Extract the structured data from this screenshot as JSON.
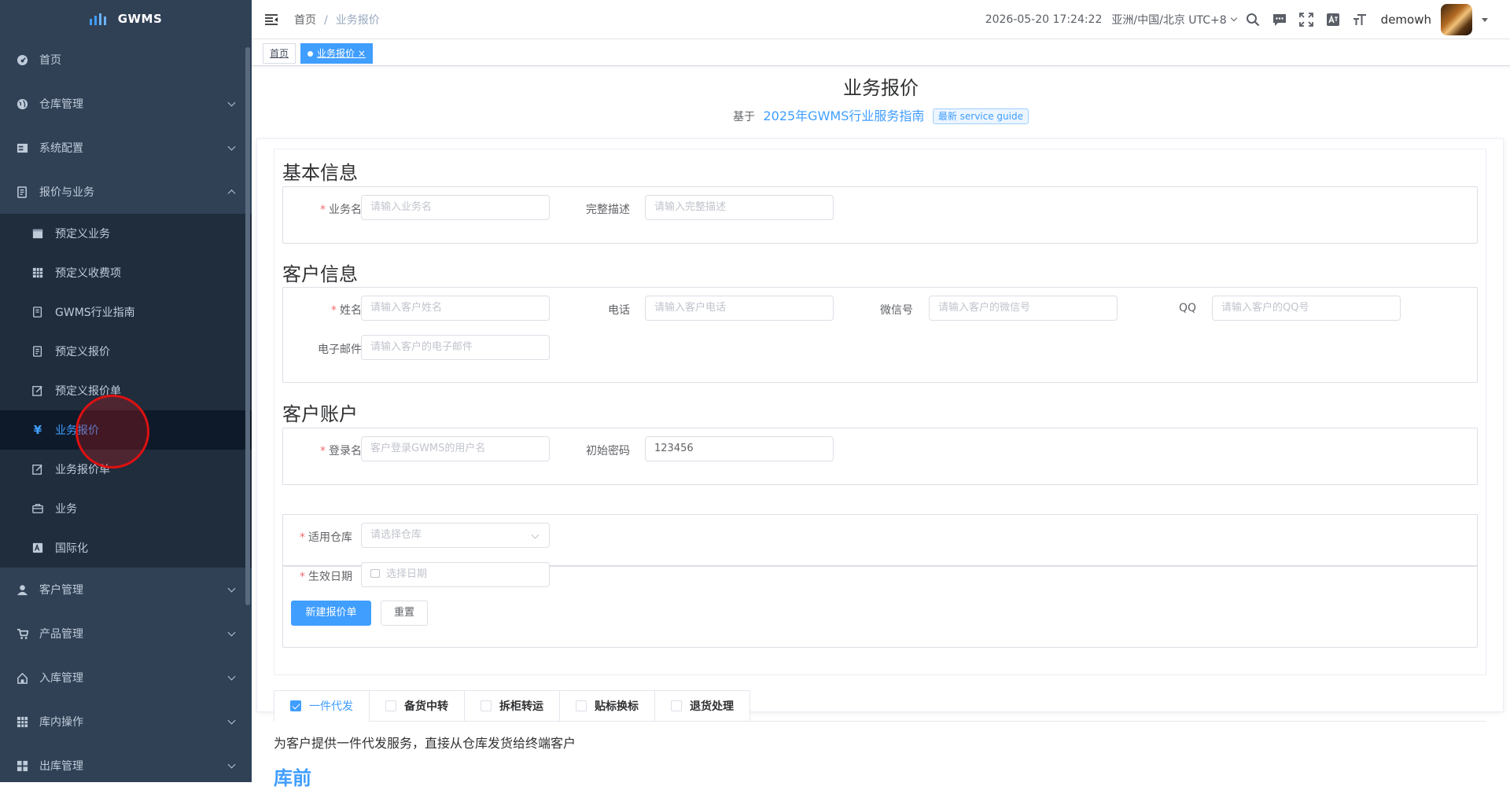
{
  "app": {
    "logo_text": "GWMS"
  },
  "sidebar": {
    "items": [
      {
        "label": "首页",
        "icon": "dashboard-icon"
      },
      {
        "label": "仓库管理",
        "icon": "globe-icon"
      },
      {
        "label": "系统配置",
        "icon": "server-icon"
      },
      {
        "label": "报价与业务",
        "icon": "quote-icon"
      }
    ],
    "sub_items": [
      {
        "label": "预定义业务",
        "icon": "calendar-icon"
      },
      {
        "label": "预定义收费项",
        "icon": "table-icon"
      },
      {
        "label": "GWMS行业指南",
        "icon": "guide-icon"
      },
      {
        "label": "预定义报价",
        "icon": "doc-icon"
      },
      {
        "label": "预定义报价单",
        "icon": "edit-icon"
      },
      {
        "label": "业务报价",
        "icon": "yen-icon"
      },
      {
        "label": "业务报价单",
        "icon": "edit-icon"
      },
      {
        "label": "业务",
        "icon": "briefcase-icon"
      },
      {
        "label": "国际化",
        "icon": "language-icon"
      }
    ],
    "bottom_items": [
      {
        "label": "客户管理",
        "icon": "user-icon"
      },
      {
        "label": "产品管理",
        "icon": "cart-icon"
      },
      {
        "label": "入库管理",
        "icon": "home-icon"
      },
      {
        "label": "库内操作",
        "icon": "grid-icon"
      },
      {
        "label": "出库管理",
        "icon": "apps-icon"
      }
    ]
  },
  "navbar": {
    "breadcrumb": [
      "首页",
      "业务报价"
    ],
    "separator": "/",
    "datetime": "2026-05-20 17:24:22",
    "timezone": "亚洲/中国/北京 UTC+8",
    "username": "demowh"
  },
  "tags": [
    {
      "label": "首页"
    },
    {
      "label": "业务报价",
      "close": "×"
    }
  ],
  "page": {
    "title": "业务报价",
    "based_on": "基于",
    "guide_link": "2025年GWMS行业服务指南",
    "guide_badge": "最新 service guide"
  },
  "form": {
    "basic": {
      "title": "基本信息",
      "name_label": "业务名",
      "name_placeholder": "请输入业务名",
      "desc_label": "完整描述",
      "desc_placeholder": "请输入完整描述"
    },
    "customer": {
      "title": "客户信息",
      "name_label": "姓名",
      "name_placeholder": "请输入客户姓名",
      "phone_label": "电话",
      "phone_placeholder": "请输入客户电话",
      "wechat_label": "微信号",
      "wechat_placeholder": "请输入客户的微信号",
      "qq_label": "QQ",
      "qq_placeholder": "请输入客户的QQ号",
      "email_label": "电子邮件",
      "email_placeholder": "请输入客户的电子邮件"
    },
    "account": {
      "title": "客户账户",
      "login_label": "登录名",
      "login_placeholder": "客户登录GWMS的用户名",
      "password_label": "初始密码",
      "password_value": "123456"
    },
    "extra": {
      "warehouse_label": "适用仓库",
      "warehouse_placeholder": "请选择仓库",
      "date_label": "生效日期",
      "date_placeholder": "选择日期",
      "create_button": "新建报价单",
      "reset_button": "重置"
    }
  },
  "tabs": [
    {
      "label": "一件代发",
      "checked": true
    },
    {
      "label": "备货中转",
      "checked": false
    },
    {
      "label": "拆柜转运",
      "checked": false
    },
    {
      "label": "贴标换标",
      "checked": false
    },
    {
      "label": "退货处理",
      "checked": false
    }
  ],
  "tab_content": {
    "description": "为客户提供一件代发服务，直接从仓库发货给终端客户",
    "section_title": "库前"
  },
  "colors": {
    "sidebar_bg": "#304156",
    "submenu_bg": "#1f2d3d",
    "accent": "#409eff",
    "required": "#f56c6c"
  }
}
